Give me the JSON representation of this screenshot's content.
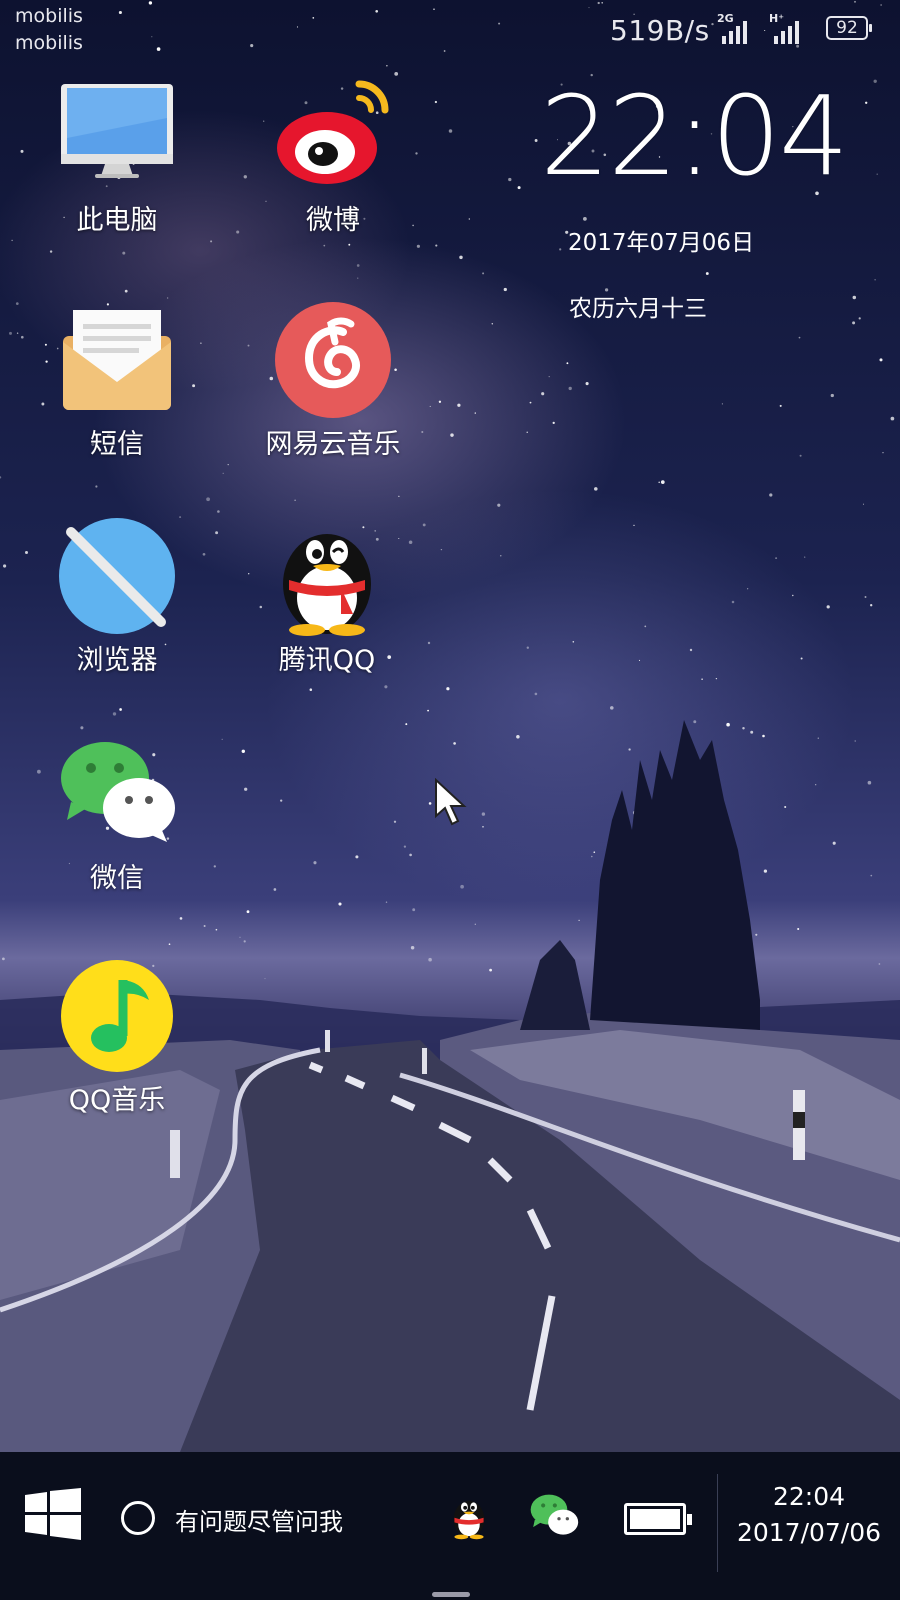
{
  "status_bar": {
    "carrier_1": "mobilis",
    "carrier_2": "mobilis",
    "net_speed": "519B/s",
    "signal_1_tag": "2G",
    "signal_2_tag": "H⁺",
    "battery_level": "92"
  },
  "clock_widget": {
    "time": "22:04",
    "date": "2017年07月06日",
    "lunar_date": "农历六月十三"
  },
  "desktop_apps": [
    {
      "label": "此电脑",
      "icon": "computer-icon"
    },
    {
      "label": "微博",
      "icon": "weibo-icon"
    },
    {
      "label": "短信",
      "icon": "sms-envelope-icon"
    },
    {
      "label": "网易云音乐",
      "icon": "netease-music-icon"
    },
    {
      "label": "浏览器",
      "icon": "browser-icon"
    },
    {
      "label": "腾讯QQ",
      "icon": "qq-penguin-icon"
    },
    {
      "label": "微信",
      "icon": "wechat-icon"
    },
    {
      "label": "QQ音乐",
      "icon": "qq-music-icon"
    }
  ],
  "taskbar": {
    "search_placeholder": "有问题尽管问我",
    "pinned": [
      "qq-penguin-icon",
      "wechat-icon"
    ],
    "battery_fill": 1.0,
    "time": "22:04",
    "date": "2017/07/06"
  },
  "colors": {
    "taskbar_bg": "#0a0e1c",
    "weibo_red": "#e6162d",
    "netease_red": "#e65a5a",
    "browser_blue": "#5fb3f0",
    "wechat_green": "#4fc05a",
    "qqmusic_yellow": "#ffde1a",
    "qqmusic_green": "#25c05f"
  }
}
